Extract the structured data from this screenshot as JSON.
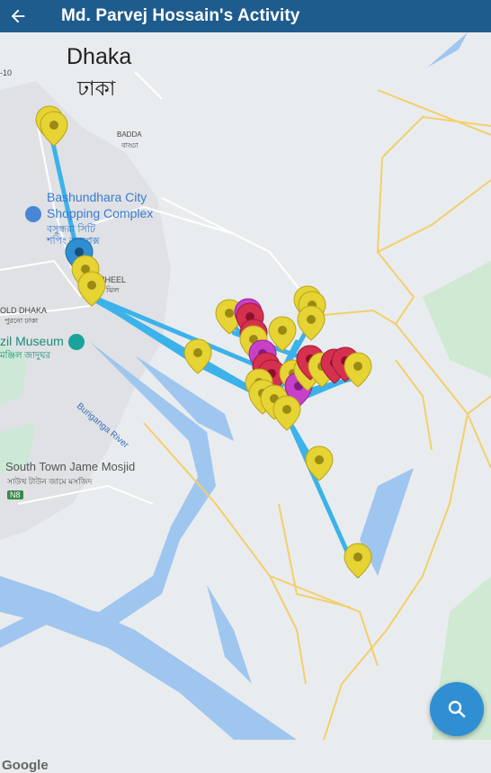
{
  "app_bar": {
    "title": "Md. Parvej Hossain's Activity",
    "back_icon": "arrow-left-icon"
  },
  "map": {
    "labels": {
      "city_en": "Dhaka",
      "city_bn": "ঢাকা",
      "badda_en": "BADDA",
      "badda_bn": "বাড্ডা",
      "bashundhara_1": "Bashundhara City",
      "bashundhara_2": "Shopping Complex",
      "bashundhara_bn1": "বসুন্ধরা সিটি",
      "bashundhara_bn2": "শপিং কমপ্লেক্স",
      "jheel": "JHEEL",
      "jheel_bn": "ঝিল",
      "old_dhaka": "OLD DHAKA",
      "old_dhaka_bn": "পুরনো ঢাকা",
      "museum": "zil Museum",
      "museum_bn": "মঞ্জিল জাদুঘর",
      "river": "Buriganga River",
      "mosque": "South Town Jame Mosjid",
      "mosque_bn": "সাউথ টাউন জামে মসজিদ",
      "road_badge": "N8",
      "edge_10": "-10"
    },
    "marker_colors": {
      "yellow": "#e6d334",
      "red": "#d6304f",
      "magenta": "#c740c8",
      "blue": "#2f8fd2",
      "route": "#3bb2ea"
    },
    "attribution": "Google"
  },
  "fab": {
    "icon": "search-icon"
  }
}
